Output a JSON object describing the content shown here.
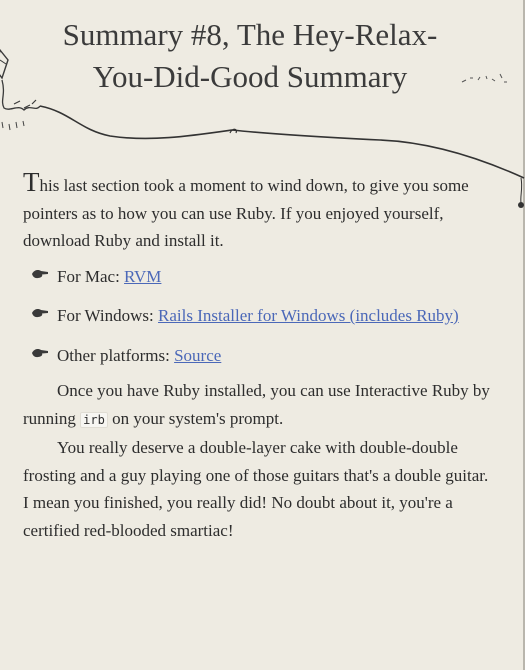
{
  "title": {
    "line1": "Summary #8, The Hey-Relax-",
    "line2": "You-Did-Good Summary"
  },
  "intro": {
    "dropcap": "T",
    "text": "his last section took a moment to wind down, to give you some pointers as to how you can use Ruby. If you enjoyed yourself, download Ruby and install it."
  },
  "platforms": [
    {
      "label": "For Mac: ",
      "link": "RVM"
    },
    {
      "label": "For Windows: ",
      "link": "Rails Installer for Windows (includes Ruby)"
    },
    {
      "label": "Other platforms: ",
      "link": "Source"
    }
  ],
  "para1": {
    "before": "Once you have Ruby installed, you can use Interactive Ruby by running ",
    "code": "irb",
    "after": " on your system's prompt."
  },
  "para2": {
    "text": "You really deserve a double-layer cake with double-double frosting and a guy playing one of those guitars that's a double guitar. I mean you finished, you really did! No doubt about it, you're a certified red-blooded smartiac!"
  },
  "icons": {
    "bullet": "hand-pointer-icon",
    "decoration": "kite-string-doodle"
  }
}
